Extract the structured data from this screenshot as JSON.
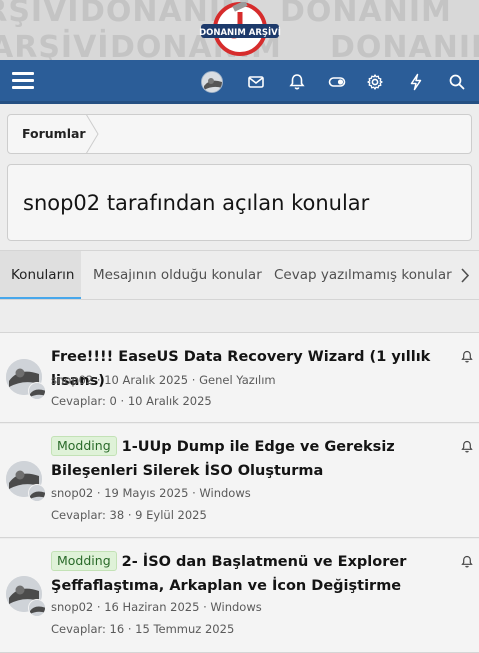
{
  "banner": {
    "logo_text": "DONANIM ARŞİVİ",
    "watermark_words": [
      "ARŞİVİ",
      "DONANIM",
      "ARŞİVİ",
      "DONANIM",
      "ARŞİVİ",
      "DONANIM",
      "ARŞİVİ",
      "DONANIM"
    ],
    "logo_ring_color": "#d62c2c",
    "logo_bar_color": "#1d3a6b"
  },
  "navbar": {
    "background": "#2b5d98",
    "icons": [
      "menu-icon",
      "avatar",
      "envelope-icon",
      "bell-icon",
      "toggle-icon",
      "gear-icon",
      "bolt-icon",
      "search-icon"
    ]
  },
  "breadcrumb": {
    "items": [
      {
        "label": "Forumlar"
      }
    ]
  },
  "page": {
    "title": "snop02 tarafından açılan konular"
  },
  "tabs": {
    "items": [
      {
        "label": "Konuların",
        "active": true
      },
      {
        "label": "Mesajının olduğu konular",
        "active": false
      },
      {
        "label": "Cevap yazılmamış konular",
        "active": false
      }
    ],
    "more_icon": "chevron-right-icon",
    "accent": "#47a7eb"
  },
  "threads": [
    {
      "prefix": "",
      "title": "Free!!!! EaseUS Data Recovery Wizard (1 yıllık lisans)",
      "author": "snop02",
      "date": "10 Aralık 2025",
      "forum": "Genel Yazılım",
      "replies_label": "Cevaplar: 0",
      "last_date": "10 Aralık 2025"
    },
    {
      "prefix": "Modding",
      "title": "1-UUp Dump ile Edge ve Gereksiz Bileşenleri Silerek İSO Oluşturma",
      "author": "snop02",
      "date": "19 Mayıs 2025",
      "forum": "Windows",
      "replies_label": "Cevaplar: 38",
      "last_date": "9 Eylül 2025"
    },
    {
      "prefix": "Modding",
      "title": "2- İSO dan Başlatmenü ve Explorer Şeffaflaştıma, Arkaplan ve İcon Değiştirme",
      "author": "snop02",
      "date": "16 Haziran 2025",
      "forum": "Windows",
      "replies_label": "Cevaplar: 16",
      "last_date": "15 Temmuz 2025"
    }
  ],
  "separator": "·",
  "prefix_color": "#dff2d8"
}
